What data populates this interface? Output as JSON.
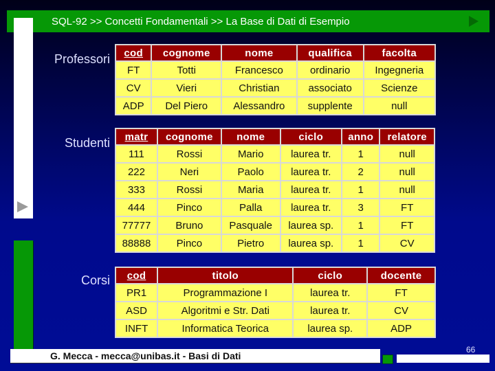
{
  "header": {
    "title": "SQL-92 >> Concetti Fondamentali >> La Base di Dati di Esempio",
    "next_icon": "play-arrow-icon"
  },
  "sidebar": {
    "play_icon": "play-arrow-icon"
  },
  "colors": {
    "header_green": "#069806",
    "table_header": "#990000",
    "table_cell": "#ffff66",
    "background": "#000a8c"
  },
  "tables": {
    "professori": {
      "label": "Professori",
      "columns": [
        "cod",
        "cognome",
        "nome",
        "qualifica",
        "facolta"
      ],
      "key_columns": [
        "cod"
      ],
      "rows": [
        [
          "FT",
          "Totti",
          "Francesco",
          "ordinario",
          "Ingegneria"
        ],
        [
          "CV",
          "Vieri",
          "Christian",
          "associato",
          "Scienze"
        ],
        [
          "ADP",
          "Del Piero",
          "Alessandro",
          "supplente",
          "null"
        ]
      ]
    },
    "studenti": {
      "label": "Studenti",
      "columns": [
        "matr",
        "cognome",
        "nome",
        "ciclo",
        "anno",
        "relatore"
      ],
      "key_columns": [
        "matr"
      ],
      "rows": [
        [
          "111",
          "Rossi",
          "Mario",
          "laurea tr.",
          "1",
          "null"
        ],
        [
          "222",
          "Neri",
          "Paolo",
          "laurea tr.",
          "2",
          "null"
        ],
        [
          "333",
          "Rossi",
          "Maria",
          "laurea tr.",
          "1",
          "null"
        ],
        [
          "444",
          "Pinco",
          "Palla",
          "laurea tr.",
          "3",
          "FT"
        ],
        [
          "77777",
          "Bruno",
          "Pasquale",
          "laurea sp.",
          "1",
          "FT"
        ],
        [
          "88888",
          "Pinco",
          "Pietro",
          "laurea sp.",
          "1",
          "CV"
        ]
      ]
    },
    "corsi": {
      "label": "Corsi",
      "columns": [
        "cod",
        "titolo",
        "ciclo",
        "docente"
      ],
      "key_columns": [
        "cod"
      ],
      "rows": [
        [
          "PR1",
          "Programmazione I",
          "laurea tr.",
          "FT"
        ],
        [
          "ASD",
          "Algoritmi e Str. Dati",
          "laurea tr.",
          "CV"
        ],
        [
          "INFT",
          "Informatica Teorica",
          "laurea sp.",
          "ADP"
        ]
      ]
    }
  },
  "footer": {
    "text": "G. Mecca - mecca@unibas.it - Basi di Dati",
    "page_number": "66"
  }
}
